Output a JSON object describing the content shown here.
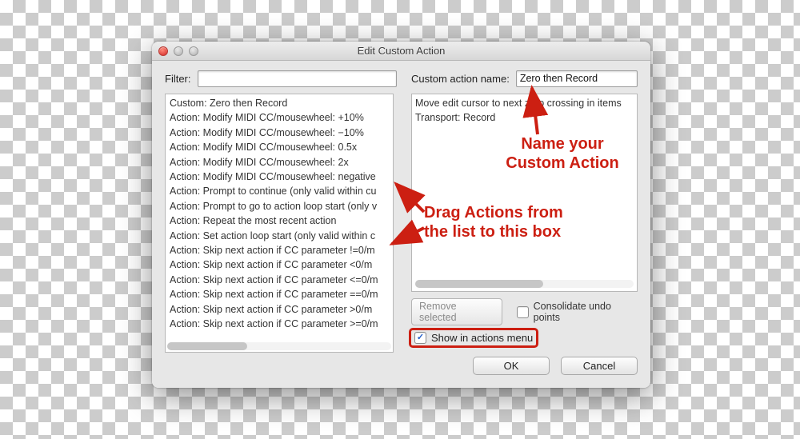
{
  "window": {
    "title": "Edit Custom Action"
  },
  "left": {
    "filter_label": "Filter:",
    "filter_value": "",
    "actions": [
      "Custom: Zero then Record",
      "Action: Modify MIDI CC/mousewheel: +10%",
      "Action: Modify MIDI CC/mousewheel: −10%",
      "Action: Modify MIDI CC/mousewheel: 0.5x",
      "Action: Modify MIDI CC/mousewheel: 2x",
      "Action: Modify MIDI CC/mousewheel: negative",
      "Action: Prompt to continue (only valid within cu",
      "Action: Prompt to go to action loop start (only v",
      "Action: Repeat the most recent action",
      "Action: Set action loop start (only valid within c",
      "Action: Skip next action if CC parameter !=0/m",
      "Action: Skip next action if CC parameter <0/m",
      "Action: Skip next action if CC parameter <=0/m",
      "Action: Skip next action if CC parameter ==0/m",
      "Action: Skip next action if CC parameter >0/m",
      "Action: Skip next action if CC parameter >=0/m"
    ]
  },
  "right": {
    "name_label": "Custom action name:",
    "name_value": "Zero then Record",
    "dropped_actions": [
      "Move edit cursor to next zero crossing in items",
      "Transport: Record"
    ],
    "remove_selected_label": "Remove selected",
    "consolidate_label": "Consolidate undo points",
    "consolidate_checked": false,
    "show_label": "Show in actions menu",
    "show_checked": true,
    "ok_label": "OK",
    "cancel_label": "Cancel"
  },
  "annotations": {
    "name_hint": "Name your\nCustom Action",
    "drag_hint": "Drag Actions from\nthe list to this box"
  },
  "colors": {
    "annotation": "#cc1f12"
  }
}
